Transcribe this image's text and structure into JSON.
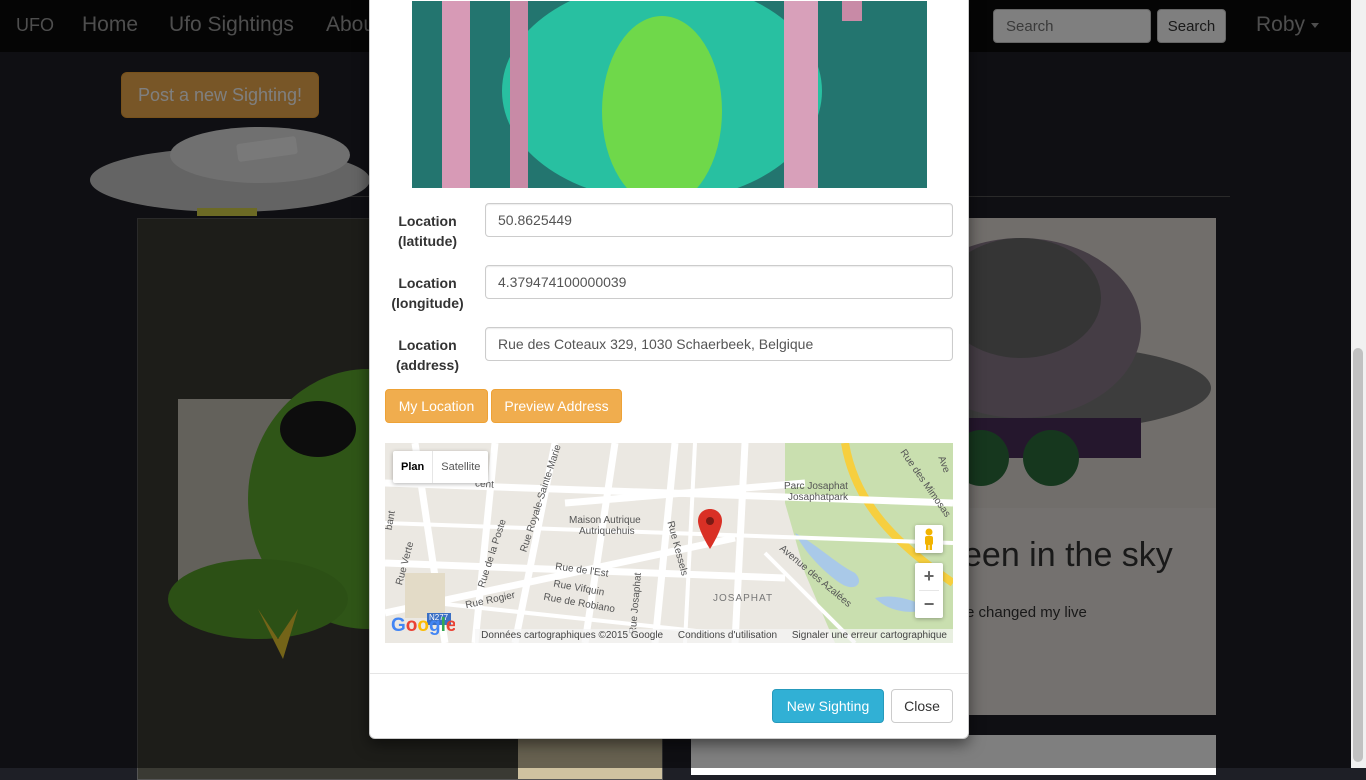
{
  "navbar": {
    "brand": "UFO",
    "links": [
      "Home",
      "Ufo Sightings",
      "About"
    ],
    "search_placeholder": "Search",
    "search_button": "Search",
    "user": "Roby"
  },
  "page": {
    "post_button": "Post a new Sighting!",
    "card_title": "seen in the sky",
    "card_text": "e changed my live"
  },
  "modal": {
    "fields": [
      {
        "label_line1": "Location",
        "label_line2": "(latitude)",
        "value": "50.8625449"
      },
      {
        "label_line1": "Location",
        "label_line2": "(longitude)",
        "value": "4.379474100000039"
      },
      {
        "label_line1": "Location",
        "label_line2": "(address)",
        "value": "Rue des Coteaux 329, 1030 Schaerbeek, Belgique"
      }
    ],
    "my_location_button": "My Location",
    "preview_address_button": "Preview Address",
    "map": {
      "type_plan": "Plan",
      "type_satellite": "Satellite",
      "labels": {
        "maison": "Maison Autrique",
        "autriquehuis": "Autriquehuis",
        "parc": "Parc Josaphat",
        "josaphatpark": "Josaphatpark",
        "josaphat": "JOSAPHAT",
        "rue_est": "Rue de l'Est",
        "rue_vifquin": "Rue Vifquin",
        "rue_robiano": "Rue de Robiano",
        "rue_rogier": "Rue Rogier",
        "rue_verte": "Rue Verte",
        "rue_poste": "Rue de la Poste",
        "rue_royale": "Rue Royale-Sainte-Marie",
        "rue_kessels": "Rue Kessels",
        "rue_josaphat": "Rue Josaphat",
        "av_azalees": "Avenue des Azalées",
        "rue_mimosas": "Rue des Mimosas",
        "n277": "N277",
        "bant": "bant",
        "cent": "cent",
        "aven": "Ave"
      },
      "footer_data": "Données cartographiques ©2015 Google",
      "footer_terms": "Conditions d'utilisation",
      "footer_report": "Signaler une erreur cartographique",
      "zoom_in": "+",
      "zoom_out": "−"
    },
    "new_sighting_button": "New Sighting",
    "close_button": "Close"
  },
  "colors": {
    "warning": "#f0ad4e",
    "info": "#31b0d5",
    "navbar": "#0a0a0a",
    "map_pin": "#d93025"
  }
}
